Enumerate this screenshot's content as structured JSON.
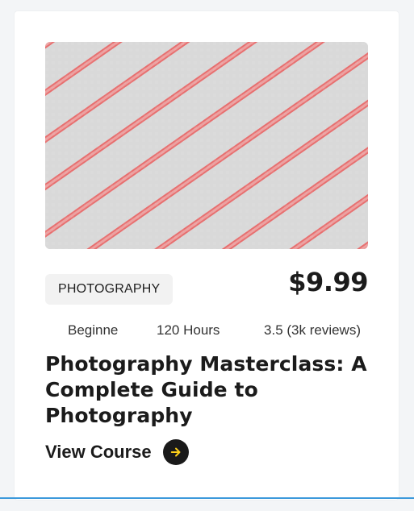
{
  "course_card": {
    "category": "PHOTOGRAPHY",
    "price": "$9.99",
    "level": "Beginne",
    "hours": "120 Hours",
    "rating": "3.5 (3k reviews)",
    "title": "Photography Masterclass: A Complete Guide to Photography",
    "cta_label": "View Course",
    "icons": {
      "cta_icon": "arrow-right-icon",
      "thumbnail": "image-placeholder-icon"
    },
    "colors": {
      "accent_yellow": "#ffd11a",
      "dark": "#1b1b1b",
      "badge_bg": "#f2f2f2",
      "placeholder_bg": "#d9d9d9",
      "placeholder_stripe": "#e76f6f",
      "bottom_rule": "#3b99db"
    }
  }
}
